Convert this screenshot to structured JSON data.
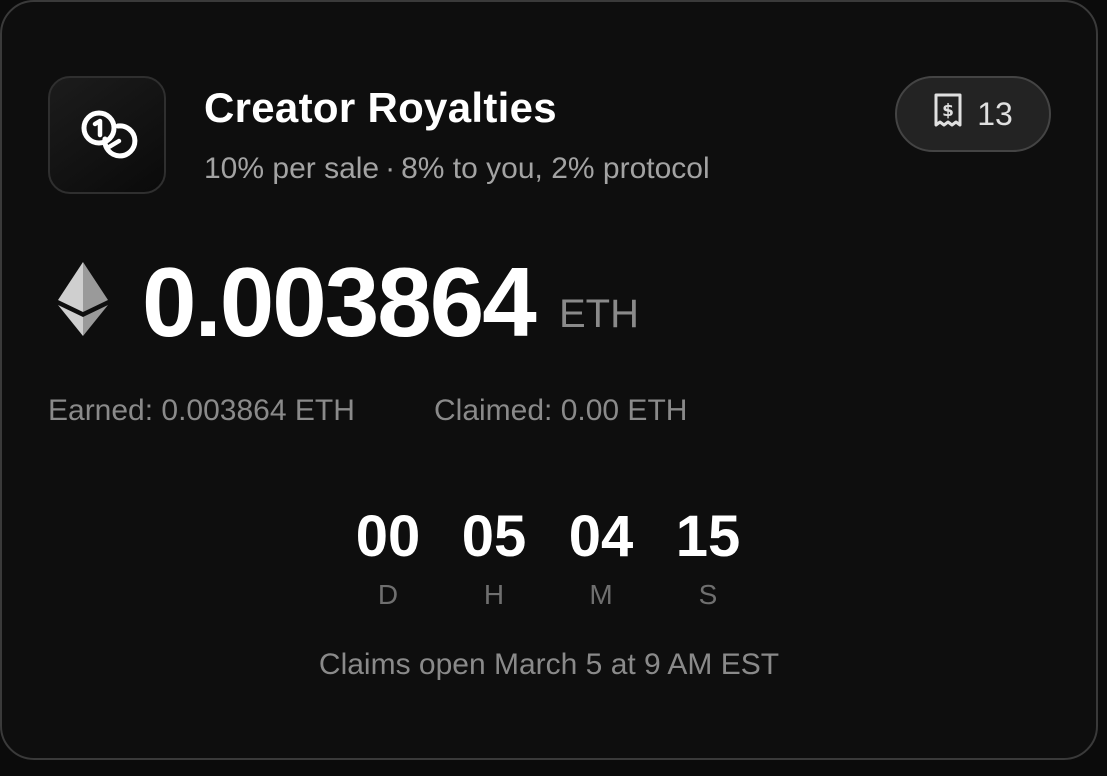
{
  "header": {
    "icon": "coins-icon",
    "title": "Creator Royalties",
    "subtitle_rate": "10% per sale",
    "subtitle_separator": "·",
    "subtitle_split": "8% to you, 2% protocol",
    "receipt_icon": "receipt-icon",
    "receipt_count": "13"
  },
  "balance": {
    "currency_icon": "ethereum-icon",
    "amount": "0.003864",
    "unit": "ETH"
  },
  "stats": {
    "earned": "Earned: 0.003864 ETH",
    "claimed": "Claimed: 0.00 ETH"
  },
  "countdown": {
    "days": "00",
    "hours": "05",
    "minutes": "04",
    "seconds": "15",
    "days_label": "D",
    "hours_label": "H",
    "minutes_label": "M",
    "seconds_label": "S"
  },
  "footer": {
    "note": "Claims open March 5 at 9 AM EST"
  },
  "colors": {
    "background": "#0e0e0e",
    "border": "#3a3a3a",
    "primary_text": "#ffffff",
    "secondary_text": "#8a8a8a"
  }
}
